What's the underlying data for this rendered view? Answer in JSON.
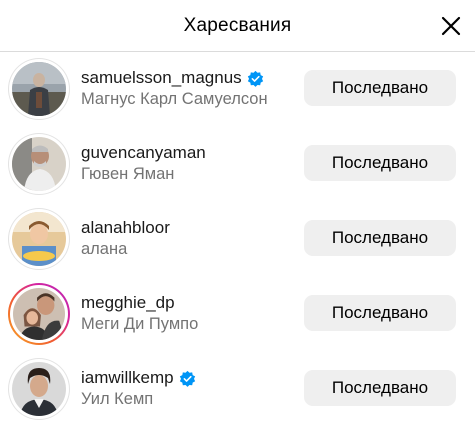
{
  "header": {
    "title": "Харесвания",
    "close_icon": "close-icon"
  },
  "users": [
    {
      "username": "samuelsson_magnus",
      "full_name": "Магнус Карл Самуелсон",
      "verified": true,
      "story_ring": false,
      "button_label": "Последвано"
    },
    {
      "username": "guvencanyaman",
      "full_name": "Гювен Яман",
      "verified": false,
      "story_ring": false,
      "button_label": "Последвано"
    },
    {
      "username": "alanahbloor",
      "full_name": "алана",
      "verified": false,
      "story_ring": false,
      "button_label": "Последвано"
    },
    {
      "username": "megghie_dp",
      "full_name": "Меги Ди Пумпо",
      "verified": false,
      "story_ring": true,
      "button_label": "Последвано"
    },
    {
      "username": "iamwillkemp",
      "full_name": "Уил Кемп",
      "verified": true,
      "story_ring": false,
      "button_label": "Последвано"
    }
  ],
  "colors": {
    "verified_badge": "#0095f6",
    "button_bg": "#efefef",
    "secondary_text": "#737373"
  }
}
